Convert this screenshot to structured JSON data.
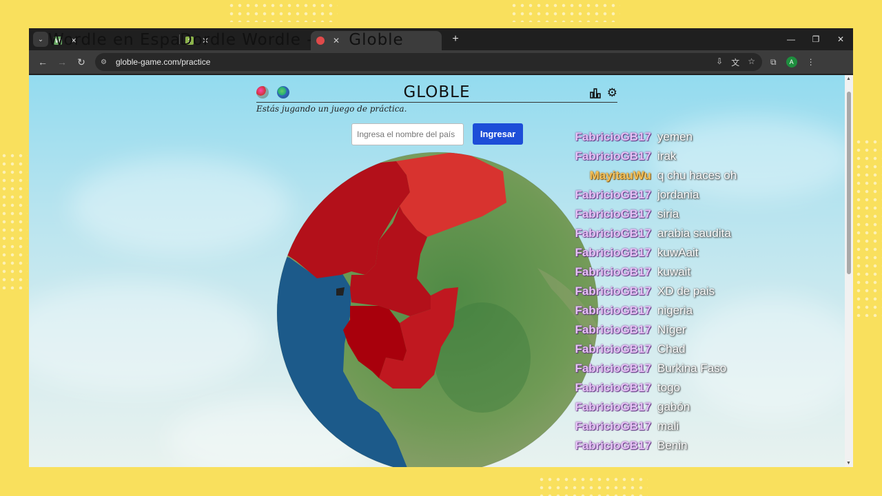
{
  "browser": {
    "tabs": [
      {
        "title": "Wordle en Español - Juega Wor",
        "favicon": "W",
        "favicon_color": "#6aaa64"
      },
      {
        "title": "Dordle Wordle - Play Dordle Ga",
        "favicon": "2",
        "favicon_color": "#8bb34a"
      },
      {
        "title": "Globle",
        "favicon": "globe",
        "favicon_color": "#e04a4a"
      }
    ],
    "url": "globle-game.com/practice",
    "profile_initial": "A"
  },
  "page": {
    "title": "GLOBLE",
    "subtitle": "Estás jugando un juego de práctica.",
    "input_placeholder": "Ingresa el nombre del país",
    "submit_label": "Ingresar"
  },
  "chat": [
    {
      "user": "FabricioGB17",
      "message": "yemen"
    },
    {
      "user": "FabricioGB17",
      "message": "irak"
    },
    {
      "user": "MayitauWu",
      "message": "q chu haces oh",
      "color": "orange"
    },
    {
      "user": "FabricioGB17",
      "message": "jordania"
    },
    {
      "user": "FabricioGB17",
      "message": "siria"
    },
    {
      "user": "FabricioGB17",
      "message": "arabia saudita"
    },
    {
      "user": "FabricioGB17",
      "message": "kuwAait"
    },
    {
      "user": "FabricioGB17",
      "message": "kuwait"
    },
    {
      "user": "FabricioGB17",
      "message": "XD de pais"
    },
    {
      "user": "FabricioGB17",
      "message": "nigeria"
    },
    {
      "user": "FabricioGB17",
      "message": "Níger"
    },
    {
      "user": "FabricioGB17",
      "message": "Chad"
    },
    {
      "user": "FabricioGB17",
      "message": "Burkina Faso"
    },
    {
      "user": "FabricioGB17",
      "message": "togo"
    },
    {
      "user": "FabricioGB17",
      "message": "gabón"
    },
    {
      "user": "FabricioGB17",
      "message": "mali"
    },
    {
      "user": "FabricioGB17",
      "message": "Benin"
    }
  ],
  "colors": {
    "accent_button": "#1d4ed8",
    "guessed_country_red": "#c0111a",
    "guessed_country_light_red": "#d8332f",
    "ocean": "#1c5a8a",
    "land": "#7c9a5a"
  }
}
